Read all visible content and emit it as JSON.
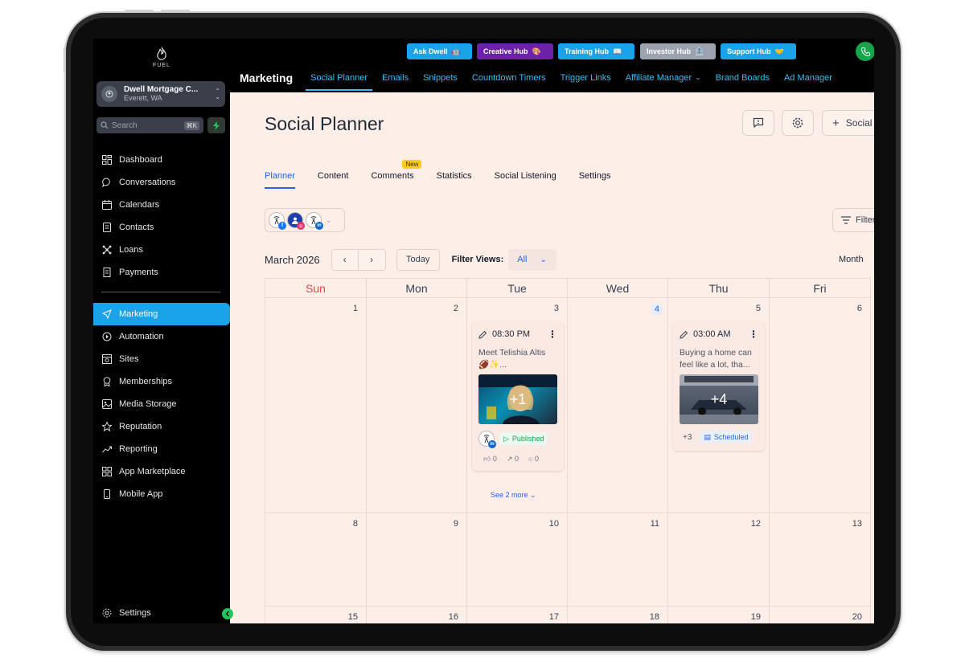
{
  "sidebar": {
    "logo_text": "FUEL",
    "account": {
      "name": "Dwell Mortgage C...",
      "location": "Everett, WA"
    },
    "search": {
      "placeholder": "Search",
      "shortcut": "⌘K"
    },
    "items": [
      {
        "label": "Dashboard",
        "icon": "grid-icon"
      },
      {
        "label": "Conversations",
        "icon": "chat-icon"
      },
      {
        "label": "Calendars",
        "icon": "calendar-icon"
      },
      {
        "label": "Contacts",
        "icon": "contacts-icon"
      },
      {
        "label": "Loans",
        "icon": "network-icon"
      },
      {
        "label": "Payments",
        "icon": "receipt-icon"
      },
      {
        "label": "Marketing",
        "icon": "send-icon"
      },
      {
        "label": "Automation",
        "icon": "automation-icon"
      },
      {
        "label": "Sites",
        "icon": "sites-icon"
      },
      {
        "label": "Memberships",
        "icon": "award-icon"
      },
      {
        "label": "Media Storage",
        "icon": "image-icon"
      },
      {
        "label": "Reputation",
        "icon": "star-icon"
      },
      {
        "label": "Reporting",
        "icon": "trend-icon"
      },
      {
        "label": "App Marketplace",
        "icon": "apps-icon"
      },
      {
        "label": "Mobile App",
        "icon": "mobile-icon"
      }
    ],
    "settings_label": "Settings"
  },
  "hubs": [
    {
      "label": "Ask Dwell",
      "color": "#1aa3e8",
      "emoji": "🤖"
    },
    {
      "label": "Creative Hub",
      "color": "#6b21a8",
      "emoji": "🎨"
    },
    {
      "label": "Training Hub",
      "color": "#1aa3e8",
      "emoji": "📖"
    },
    {
      "label": "Investor Hub",
      "color": "#9ca3af",
      "emoji": "🏦"
    },
    {
      "label": "Support Hub",
      "color": "#1aa3e8",
      "emoji": "🤝"
    }
  ],
  "topnav": {
    "section": "Marketing",
    "items": [
      "Social Planner",
      "Emails",
      "Snippets",
      "Countdown Timers",
      "Trigger Links",
      "Affiliate Manager",
      "Brand Boards",
      "Ad Manager"
    ]
  },
  "page": {
    "title": "Social Planner",
    "social_button": "Social",
    "tabs": [
      "Planner",
      "Content",
      "Comments",
      "Statistics",
      "Social Listening",
      "Settings"
    ],
    "new_badge": "New",
    "filters_label": "Filters"
  },
  "calendar": {
    "month": "March 2026",
    "today_label": "Today",
    "filter_views_label": "Filter Views:",
    "filter_views_value": "All",
    "view_label": "Month",
    "weekdays": [
      "Sun",
      "Mon",
      "Tue",
      "Wed",
      "Thu",
      "Fri"
    ],
    "weeks": [
      [
        "1",
        "2",
        "3",
        "4",
        "5",
        "6"
      ],
      [
        "8",
        "9",
        "10",
        "11",
        "12",
        "13"
      ],
      [
        "15",
        "16",
        "17",
        "18",
        "19",
        "20"
      ]
    ],
    "today_day": "4"
  },
  "posts": [
    {
      "time": "08:30 PM",
      "text": "Meet Telishia Altis 🏈✨...",
      "extra_count": "+1",
      "status": "Published",
      "likes": "0",
      "shares": "0",
      "comments": "0",
      "see_more": "See 2 more"
    },
    {
      "time": "03:00 AM",
      "text": "Buying a home can feel like a lot, tha...",
      "extra_count": "+4",
      "more_accounts": "+3",
      "status": "Scheduled"
    }
  ],
  "colors": {
    "accent": "#1aa3e8",
    "link": "#2563eb",
    "published": "#16a34a",
    "background": "#fdeee8"
  }
}
